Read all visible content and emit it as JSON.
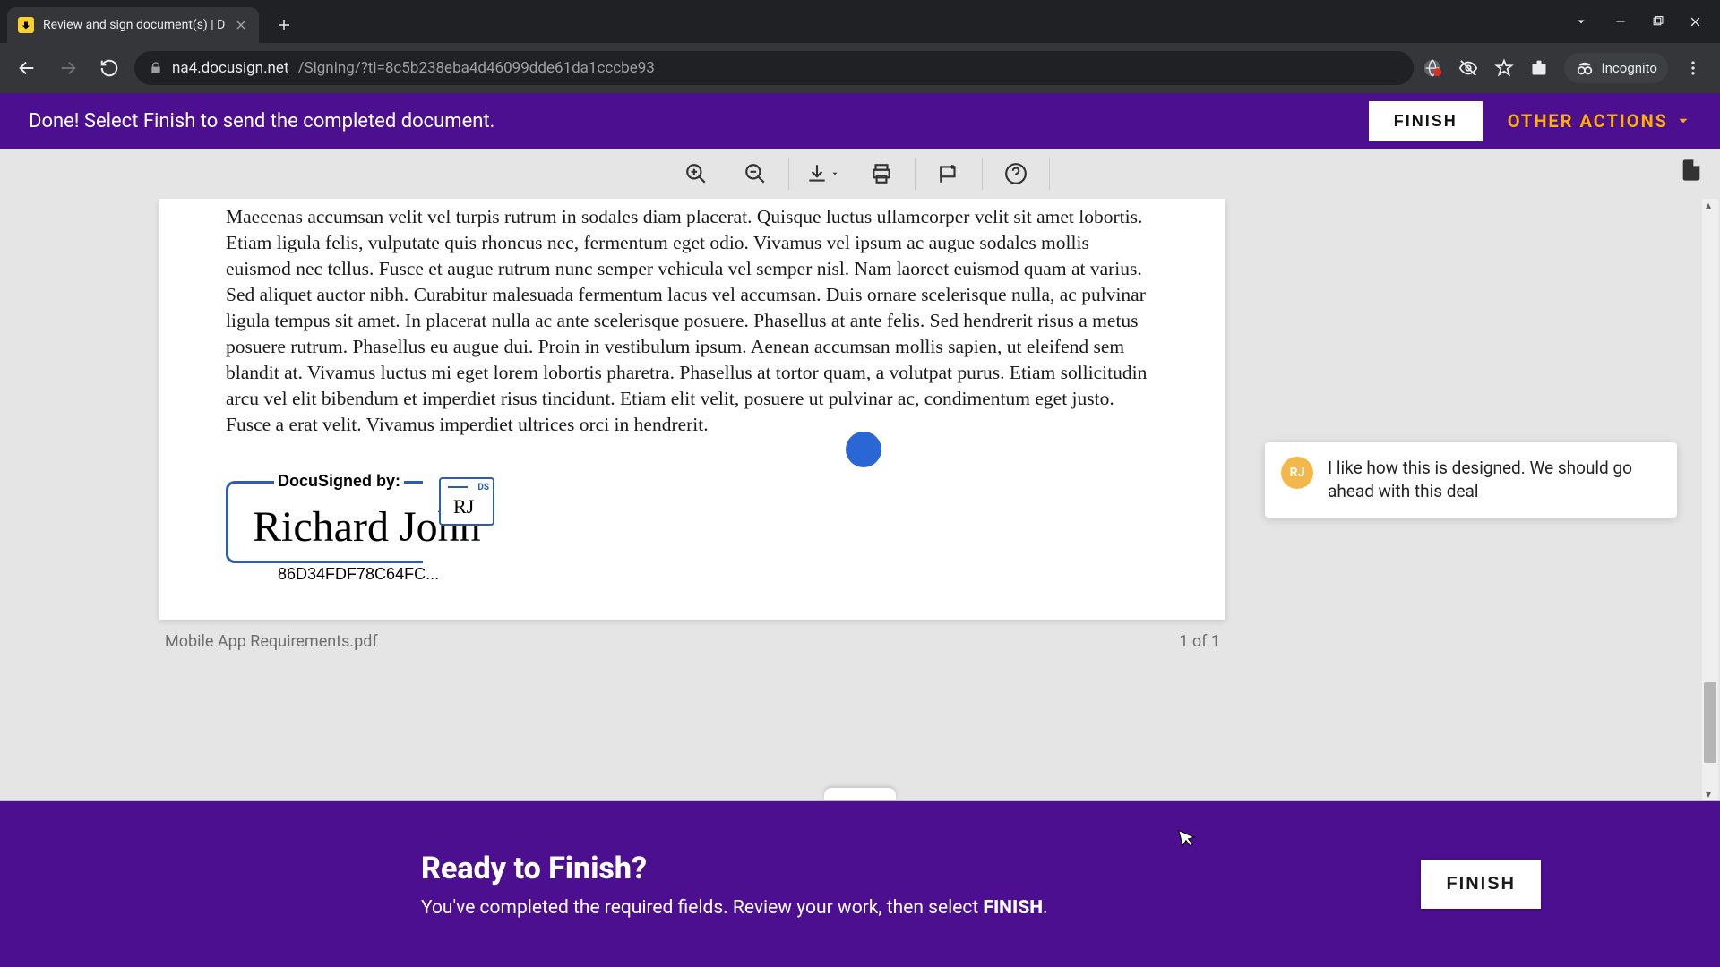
{
  "browser": {
    "tab_title": "Review and sign document(s) | D",
    "url_domain": "na4.docusign.net",
    "url_path": "/Signing/?ti=8c5b238eba4d46099dde61da1cccbe93",
    "incognito_label": "Incognito"
  },
  "header": {
    "message": "Done! Select Finish to send the completed document.",
    "finish_label": "FINISH",
    "other_actions_label": "OTHER ACTIONS"
  },
  "document": {
    "body_text": "Maecenas accumsan velit vel turpis rutrum in sodales diam placerat. Quisque luctus ullamcorper velit sit amet lobortis. Etiam ligula felis, vulputate quis rhoncus nec, fermentum eget odio. Vivamus vel ipsum ac augue sodales mollis euismod nec tellus. Fusce et augue rutrum nunc semper vehicula vel semper nisl. Nam laoreet euismod quam at varius. Sed aliquet auctor nibh. Curabitur malesuada fermentum lacus vel accumsan. Duis ornare scelerisque nulla, ac pulvinar ligula tempus sit amet. In placerat nulla ac ante scelerisque posuere. Phasellus at ante felis. Sed hendrerit risus a metus posuere rutrum. Phasellus eu augue dui. Proin in vestibulum ipsum. Aenean accumsan mollis sapien, ut eleifend sem blandit at. Vivamus luctus mi eget lorem lobortis pharetra. Phasellus at tortor quam, a volutpat purus. Etiam sollicitudin arcu vel elit bibendum et imperdiet risus tincidunt. Etiam elit velit, posuere ut pulvinar ac, condimentum eget justo. Fusce a erat velit. Vivamus imperdiet ultrices orci in hendrerit.",
    "signed_by_label": "DocuSigned by:",
    "signature_name": "Richard John",
    "initials": "RJ",
    "ds_tag": "DS",
    "hash": "86D34FDF78C64FC...",
    "filename": "Mobile App Requirements.pdf",
    "page_indicator": "1 of 1"
  },
  "comment": {
    "avatar_initials": "RJ",
    "text": "I like how this is designed. We should go ahead with this deal"
  },
  "bottom": {
    "heading": "Ready to Finish?",
    "subtext_prefix": "You've completed the required fields. Review your work, then select ",
    "subtext_bold": "FINISH",
    "subtext_suffix": ".",
    "finish_label": "FINISH"
  }
}
